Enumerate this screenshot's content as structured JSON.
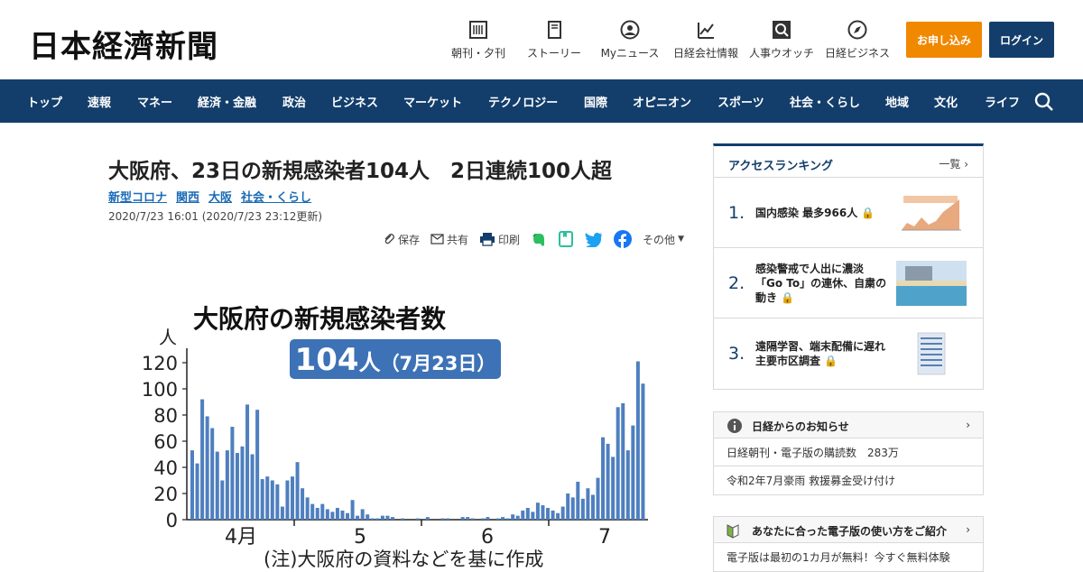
{
  "header": {
    "logo": "日本経濟新聞",
    "icons": [
      {
        "label": "朝刊・夕刊",
        "icon": "newspaper-icon"
      },
      {
        "label": "ストーリー",
        "icon": "book-icon"
      },
      {
        "label": "Myニュース",
        "icon": "user-icon"
      },
      {
        "label": "日経会社情報",
        "icon": "chart-icon"
      },
      {
        "label": "人事ウオッチ",
        "icon": "search-person-icon"
      },
      {
        "label": "日経ビジネス",
        "icon": "compass-icon"
      }
    ],
    "subscribe_label": "お申し込み",
    "login_label": "ログイン"
  },
  "nav": {
    "items": [
      "トップ",
      "速報",
      "マネー",
      "経済・金融",
      "政治",
      "ビジネス",
      "マーケット",
      "テクノロジー",
      "国際",
      "オピニオン",
      "スポーツ",
      "社会・くらし",
      "地域",
      "文化",
      "ライフ"
    ]
  },
  "article": {
    "title": "大阪府、23日の新規感染者104人　2日連続100人超",
    "tags": [
      "新型コロナ",
      "関西",
      "大阪",
      "社会・くらし"
    ],
    "date": "2020/7/23 16:01 (2020/7/23 23:12更新)",
    "share": {
      "save": "保存",
      "share": "共有",
      "print": "印刷",
      "more": "その他"
    }
  },
  "chart_data": {
    "type": "bar",
    "title": "大阪府の新規感染者数",
    "badge": {
      "value": "104",
      "unit": "人",
      "date": "（7月23日）"
    },
    "ylabel": "人",
    "ylim": [
      0,
      130
    ],
    "yticks": [
      0,
      20,
      40,
      60,
      80,
      100,
      120
    ],
    "month_labels": [
      "4月",
      "5",
      "6",
      "7"
    ],
    "note": "(注)大阪府の資料などを基に作成",
    "color": "#4e7fbf",
    "values": [
      53,
      43,
      92,
      79,
      70,
      52,
      30,
      53,
      71,
      51,
      56,
      88,
      50,
      84,
      31,
      33,
      30,
      27,
      10,
      30,
      33,
      44,
      24,
      17,
      12,
      9,
      12,
      8,
      6,
      9,
      7,
      5,
      15,
      3,
      8,
      4,
      1,
      1,
      3,
      3,
      2,
      0,
      1,
      0,
      0,
      1,
      0,
      2,
      0,
      0,
      1,
      1,
      0,
      0,
      2,
      2,
      1,
      0,
      1,
      2,
      0,
      1,
      2,
      1,
      4,
      3,
      7,
      9,
      6,
      13,
      11,
      9,
      7,
      5,
      10,
      20,
      17,
      29,
      16,
      24,
      19,
      32,
      63,
      58,
      48,
      86,
      89,
      53,
      72,
      121,
      104
    ]
  },
  "ranking": {
    "title": "アクセスランキング",
    "more": "一覧",
    "items": [
      {
        "rank": "1.",
        "text": "国内感染 最多966人"
      },
      {
        "rank": "2.",
        "text": "感染警戒で人出に濃淡「Go To」の連休、自粛の動き"
      },
      {
        "rank": "3.",
        "text": "遠隔学習、端末配備に遅れ主要市区調査"
      }
    ]
  },
  "notice": {
    "title": "日経からのお知らせ",
    "rows": [
      "日経朝刊・電子版の購読数　283万",
      "令和2年7月豪雨 救援募金受け付け"
    ]
  },
  "guide": {
    "title": "あなたに合った電子版の使い方をご紹介",
    "rows": [
      "電子版は最初の1カ月が無料！今すぐ無料体験"
    ]
  },
  "colors": {
    "navy": "#133e6b",
    "orange": "#f08800",
    "link": "#1a6bb5",
    "bar": "#4e7fbf"
  }
}
